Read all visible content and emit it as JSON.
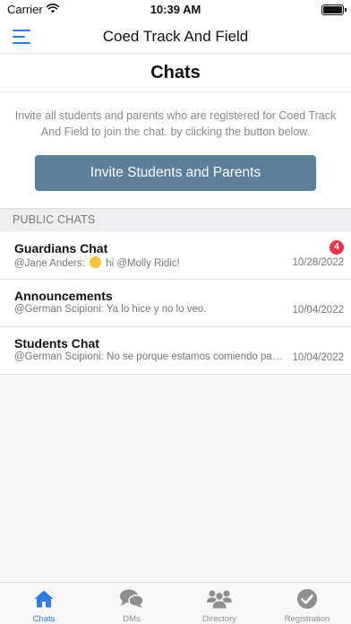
{
  "status_bar": {
    "carrier": "Carrier",
    "time": "10:39 AM"
  },
  "nav": {
    "title": "Coed Track And Field",
    "menu_icon": "hamburger-menu-icon"
  },
  "page": {
    "title": "Chats"
  },
  "invite": {
    "text": "Invite all students and parents who are registered for Coed Track And Field to join the chat. by clicking the button below.",
    "button_label": "Invite Students and Parents"
  },
  "section": {
    "header": "PUBLIC CHATS"
  },
  "chats": [
    {
      "name": "Guardians Chat",
      "preview_before": "@Jane Anders:",
      "preview_after": "hi @Molly Ridic!",
      "date": "10/28/2022",
      "unread": "4"
    },
    {
      "name": "Announcements",
      "preview": "@German Scipioni: Ya lo hice y no lo veo.",
      "date": "10/04/2022"
    },
    {
      "name": "Students Chat",
      "preview": "@German Scipioni: No se porque estamos comiendo papas",
      "date": "10/04/2022"
    }
  ],
  "tabs": [
    {
      "label": "Chats",
      "icon": "home-icon",
      "active": true
    },
    {
      "label": "DMs",
      "icon": "chat-bubbles-icon",
      "active": false
    },
    {
      "label": "Directory",
      "icon": "people-icon",
      "active": false
    },
    {
      "label": "Registration",
      "icon": "checkmark-circle-icon",
      "active": false
    }
  ],
  "colors": {
    "accent": "#2f7de1",
    "button": "#5c7f9b",
    "badge": "#e83545",
    "inactive_icon": "#8e8e8e"
  }
}
